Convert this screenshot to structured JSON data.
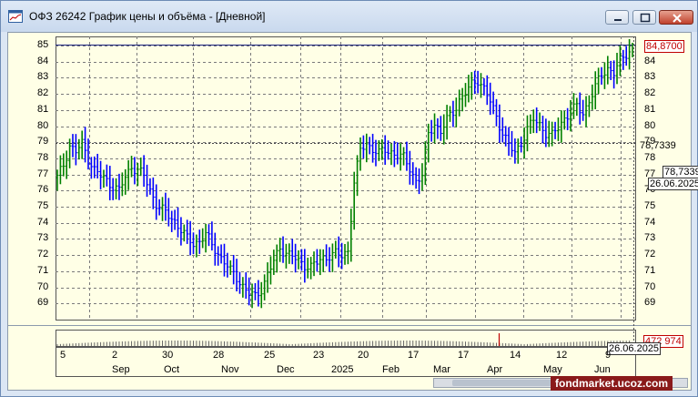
{
  "window": {
    "title": "ОФЗ 26242 График цены и объёма - [Дневной]",
    "buttons": {
      "minimize": "minimize-icon",
      "maximize": "maximize-icon",
      "close": "close-icon"
    }
  },
  "colors": {
    "up": "#008000",
    "down": "#0000ff",
    "background": "#ffffe6",
    "grid": "#7a7a7a",
    "last_price_line": "#1a237e",
    "price_tag": "#c00000"
  },
  "price_axis": {
    "ticks": [
      "85",
      "84",
      "83",
      "82",
      "81",
      "80",
      "79",
      "78",
      "77",
      "76",
      "75",
      "74",
      "73",
      "72",
      "71",
      "70",
      "69"
    ]
  },
  "right_axis": {
    "ticks": [
      "84",
      "83",
      "82",
      "81",
      "80",
      "79",
      "78",
      "77",
      "76",
      "75",
      "74",
      "73",
      "72",
      "71",
      "70",
      "69"
    ]
  },
  "last_price": "84,8700",
  "crosshair_price": "78,7339",
  "cursor_price": "78,7339",
  "cursor_date": "26.06.2025",
  "volume": {
    "value": "472 974",
    "date": "26.06.2025"
  },
  "x_axis": {
    "days": [
      "5",
      "2",
      "30",
      "28",
      "25",
      "23",
      "20",
      "17",
      "17",
      "14",
      "12",
      "9"
    ],
    "months": [
      "Sep",
      "Oct",
      "Nov",
      "Dec",
      "2025",
      "Feb",
      "Mar",
      "Apr",
      "May",
      "Jun"
    ]
  },
  "watermark": "fondmarket.ucoz.com",
  "chart_data": {
    "type": "bar",
    "title": "",
    "y_range": [
      68.5,
      85.3
    ],
    "series": [
      {
        "name": "price",
        "points": [
          [
            0,
            76.8
          ],
          [
            2,
            77.6
          ],
          [
            4,
            78.8
          ],
          [
            6,
            78.4
          ],
          [
            8,
            78.9
          ],
          [
            10,
            78.0
          ],
          [
            12,
            77.3
          ],
          [
            14,
            76.9
          ],
          [
            16,
            76.6
          ],
          [
            18,
            76.3
          ],
          [
            20,
            76.0
          ],
          [
            22,
            76.8
          ],
          [
            24,
            77.5
          ],
          [
            26,
            77.3
          ],
          [
            28,
            76.9
          ],
          [
            30,
            76.0
          ],
          [
            32,
            75.2
          ],
          [
            34,
            74.8
          ],
          [
            36,
            74.4
          ],
          [
            38,
            74.1
          ],
          [
            40,
            73.6
          ],
          [
            42,
            73.0
          ],
          [
            44,
            72.7
          ],
          [
            46,
            72.9
          ],
          [
            48,
            73.3
          ],
          [
            50,
            72.6
          ],
          [
            52,
            72.1
          ],
          [
            54,
            71.6
          ],
          [
            56,
            71.0
          ],
          [
            58,
            70.6
          ],
          [
            60,
            70.1
          ],
          [
            62,
            69.6
          ],
          [
            64,
            69.4
          ],
          [
            66,
            69.9
          ],
          [
            68,
            70.8
          ],
          [
            70,
            71.6
          ],
          [
            72,
            72.4
          ],
          [
            74,
            72.2
          ],
          [
            76,
            71.9
          ],
          [
            78,
            71.6
          ],
          [
            80,
            71.4
          ],
          [
            82,
            71.3
          ],
          [
            84,
            71.5
          ],
          [
            86,
            71.8
          ],
          [
            88,
            72.0
          ],
          [
            90,
            72.1
          ],
          [
            92,
            71.9
          ],
          [
            94,
            72.3
          ],
          [
            96,
            76.5
          ],
          [
            98,
            78.5
          ],
          [
            100,
            78.9
          ],
          [
            102,
            78.6
          ],
          [
            104,
            78.3
          ],
          [
            106,
            78.5
          ],
          [
            108,
            78.4
          ],
          [
            110,
            78.2
          ],
          [
            112,
            78.0
          ],
          [
            114,
            77.4
          ],
          [
            116,
            76.6
          ],
          [
            118,
            76.9
          ],
          [
            120,
            79.5
          ],
          [
            122,
            80.2
          ],
          [
            124,
            79.6
          ],
          [
            126,
            80.4
          ],
          [
            128,
            80.9
          ],
          [
            130,
            81.6
          ],
          [
            132,
            82.0
          ],
          [
            134,
            82.6
          ],
          [
            136,
            82.9
          ],
          [
            138,
            82.3
          ],
          [
            140,
            81.5
          ],
          [
            142,
            80.6
          ],
          [
            144,
            79.6
          ],
          [
            146,
            78.8
          ],
          [
            148,
            78.3
          ],
          [
            150,
            79.0
          ],
          [
            152,
            79.8
          ],
          [
            154,
            80.4
          ],
          [
            156,
            80.1
          ],
          [
            158,
            79.6
          ],
          [
            160,
            79.4
          ],
          [
            162,
            79.9
          ],
          [
            164,
            80.5
          ],
          [
            166,
            80.9
          ],
          [
            168,
            81.2
          ],
          [
            170,
            80.8
          ],
          [
            172,
            81.6
          ],
          [
            174,
            82.4
          ],
          [
            176,
            83.2
          ],
          [
            178,
            83.6
          ],
          [
            180,
            83.3
          ],
          [
            182,
            84.0
          ],
          [
            184,
            84.5
          ],
          [
            186,
            84.87
          ]
        ]
      }
    ]
  }
}
